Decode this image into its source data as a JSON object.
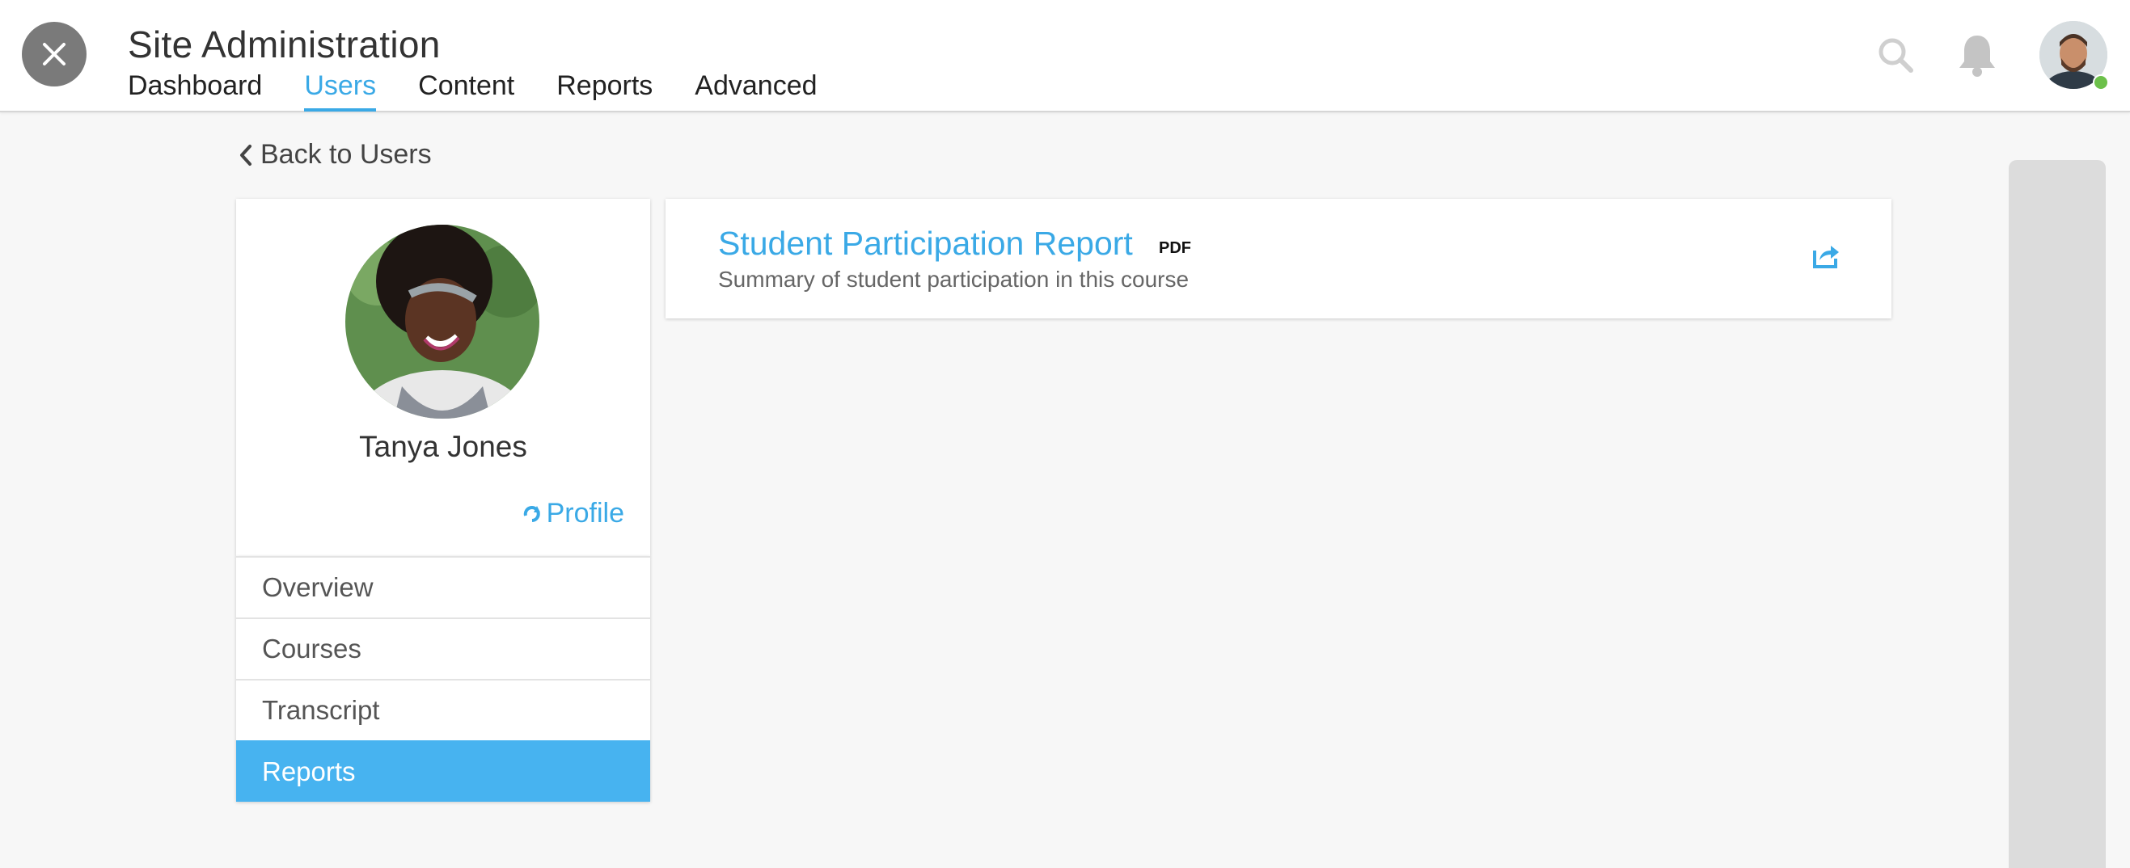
{
  "header": {
    "title": "Site Administration",
    "tabs": [
      {
        "label": "Dashboard",
        "active": false
      },
      {
        "label": "Users",
        "active": true
      },
      {
        "label": "Content",
        "active": false
      },
      {
        "label": "Reports",
        "active": false
      },
      {
        "label": "Advanced",
        "active": false
      }
    ],
    "icons": {
      "close": "close-icon",
      "search": "search-icon",
      "notifications": "bell-icon"
    },
    "user_status_color": "#6cc04a"
  },
  "back_link": {
    "label": "Back to Users"
  },
  "profile": {
    "name": "Tanya Jones",
    "profile_link": "Profile"
  },
  "menu": {
    "items": [
      {
        "label": "Overview",
        "active": false
      },
      {
        "label": "Courses",
        "active": false
      },
      {
        "label": "Transcript",
        "active": false
      },
      {
        "label": "Reports",
        "active": true
      }
    ]
  },
  "report": {
    "title": "Student Participation Report",
    "badge": "PDF",
    "description": "Summary of student participation in this course"
  },
  "colors": {
    "accent": "#3aa9e6",
    "active_menu": "#47b3f0"
  }
}
